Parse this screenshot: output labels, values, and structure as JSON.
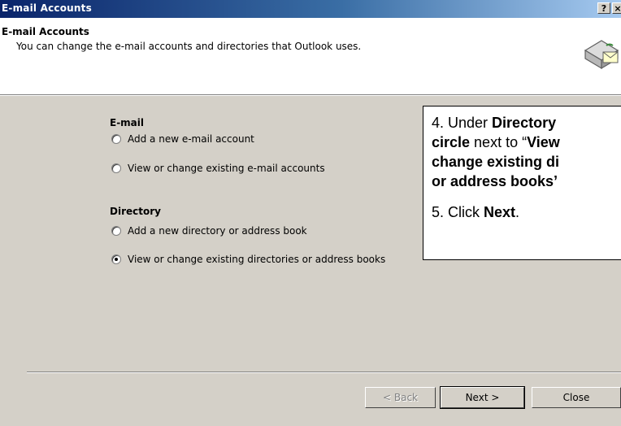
{
  "window": {
    "title": "E-mail Accounts",
    "help_label": "?",
    "close_label": "×"
  },
  "header": {
    "title": "E-mail Accounts",
    "subtitle": "You can change the e-mail accounts and directories that Outlook uses.",
    "icon": "mailbox-icon"
  },
  "email_section": {
    "heading": "E-mail",
    "options": [
      {
        "label": "Add a new e-mail account",
        "checked": false
      },
      {
        "label": "View or change existing e-mail accounts",
        "checked": false
      }
    ]
  },
  "directory_section": {
    "heading": "Directory",
    "options": [
      {
        "label": "Add a new directory or address book",
        "checked": false
      },
      {
        "label": "View or change existing directories or address books",
        "checked": true
      }
    ]
  },
  "callout": {
    "step4": {
      "prefix": "4.  Under ",
      "bold1": "Directory",
      "line2_bold": "circle",
      "line2_text": " next to “",
      "line2_bold2": "View",
      "line3": "change existing di",
      "line4": "or address books’"
    },
    "step5": {
      "prefix": "5.  Click ",
      "bold": "Next",
      "suffix": "."
    }
  },
  "buttons": {
    "back": "< Back",
    "next": "Next >",
    "close": "Close"
  },
  "colors": {
    "titlebar_start": "#0a246a",
    "titlebar_end": "#a6caf0",
    "dialog_face": "#d4d0c8"
  }
}
